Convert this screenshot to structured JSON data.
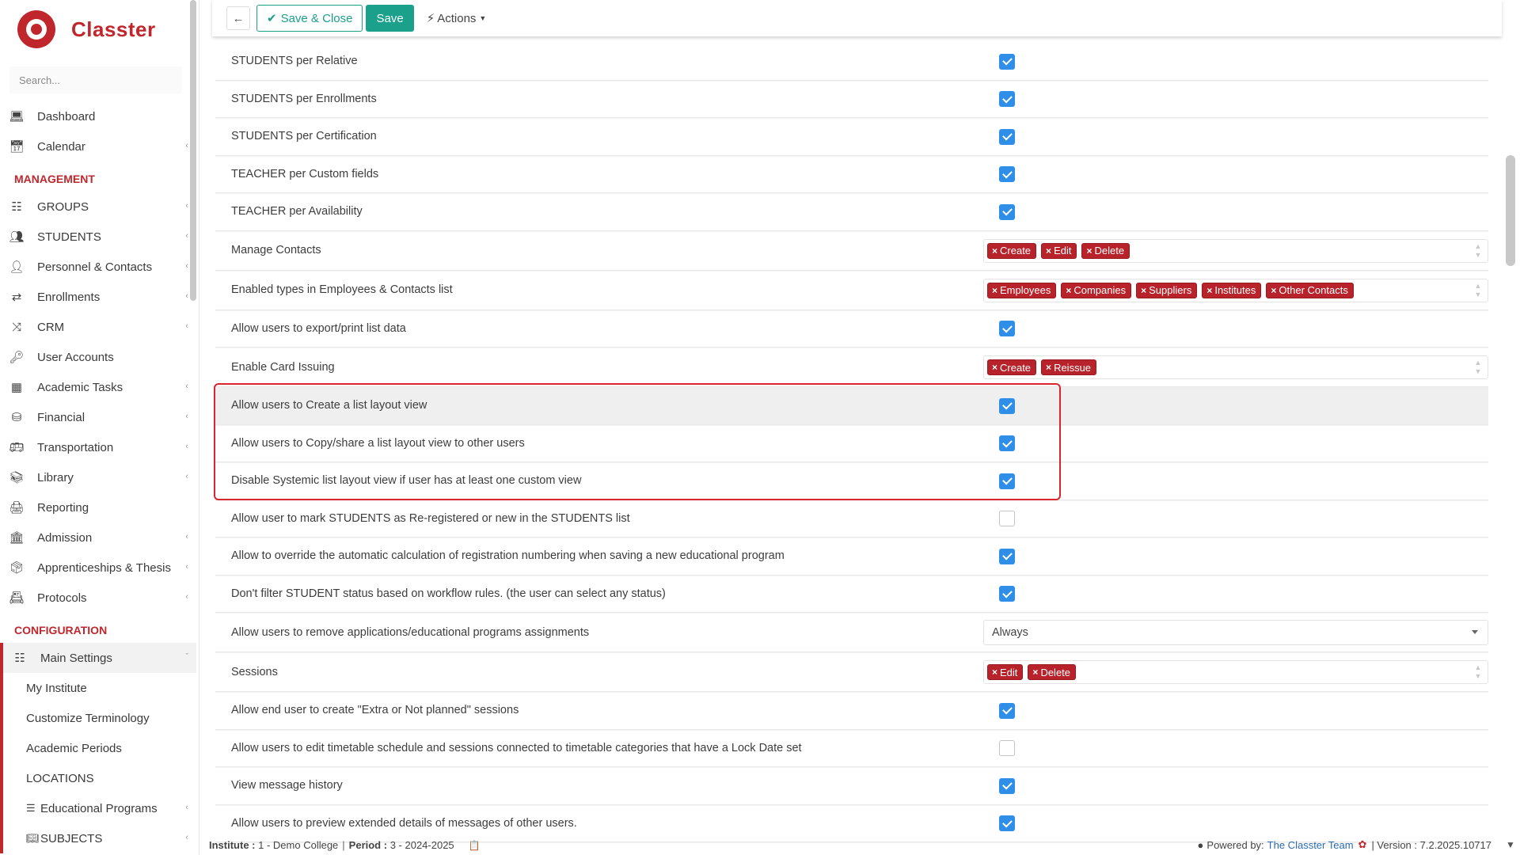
{
  "app": {
    "name": "Classter"
  },
  "search": {
    "placeholder": "Search..."
  },
  "toolbar": {
    "save_close_label": "Save & Close",
    "save_label": "Save",
    "actions_label": "Actions"
  },
  "sidebar": {
    "items_top": [
      {
        "label": "Dashboard",
        "icon": "laptop-icon",
        "chevron": false
      },
      {
        "label": "Calendar",
        "icon": "calendar-icon",
        "chevron": true
      }
    ],
    "section_management": "MANAGEMENT",
    "items_management": [
      {
        "label": "GROUPS",
        "icon": "groups-icon",
        "chevron": true
      },
      {
        "label": "STUDENTS",
        "icon": "students-icon",
        "chevron": true
      },
      {
        "label": "Personnel & Contacts",
        "icon": "person-icon",
        "chevron": true
      },
      {
        "label": "Enrollments",
        "icon": "exchange-icon",
        "chevron": true
      },
      {
        "label": "CRM",
        "icon": "shuffle-icon",
        "chevron": true
      },
      {
        "label": "User Accounts",
        "icon": "key-icon",
        "chevron": false
      },
      {
        "label": "Academic Tasks",
        "icon": "grid-icon",
        "chevron": true
      },
      {
        "label": "Financial",
        "icon": "coins-icon",
        "chevron": true
      },
      {
        "label": "Transportation",
        "icon": "bus-icon",
        "chevron": true
      },
      {
        "label": "Library",
        "icon": "books-icon",
        "chevron": true
      },
      {
        "label": "Reporting",
        "icon": "printer-icon",
        "chevron": false
      },
      {
        "label": "Admission",
        "icon": "institution-icon",
        "chevron": true
      },
      {
        "label": "Apprenticeships & Thesis",
        "icon": "box-icon",
        "chevron": true
      },
      {
        "label": "Protocols",
        "icon": "protocol-icon",
        "chevron": true
      }
    ],
    "section_configuration": "CONFIGURATION",
    "main_settings": "Main Settings",
    "sub_items": [
      {
        "label": "My Institute"
      },
      {
        "label": "Customize Terminology"
      },
      {
        "label": "Academic Periods"
      },
      {
        "label": "LOCATIONS"
      },
      {
        "label": "Educational Programs"
      },
      {
        "label": "SUBJECTS"
      }
    ]
  },
  "rows": [
    {
      "label": "STUDENTS per Relative",
      "type": "checkbox",
      "checked": true
    },
    {
      "label": "STUDENTS per Enrollments",
      "type": "checkbox",
      "checked": true
    },
    {
      "label": "STUDENTS per Certification",
      "type": "checkbox",
      "checked": true
    },
    {
      "label": "TEACHER per Custom fields",
      "type": "checkbox",
      "checked": true
    },
    {
      "label": "TEACHER per Availability",
      "type": "checkbox",
      "checked": true
    },
    {
      "label": "Manage Contacts",
      "type": "tags",
      "tags": [
        "Create",
        "Edit",
        "Delete"
      ]
    },
    {
      "label": "Enabled types in Employees & Contacts list",
      "type": "tags",
      "tags": [
        "Employees",
        "Companies",
        "Suppliers",
        "Institutes",
        "Other Contacts"
      ]
    },
    {
      "label": "Allow users to export/print list data",
      "type": "checkbox",
      "checked": true
    },
    {
      "label": "Enable Card Issuing",
      "type": "tags",
      "tags": [
        "Create",
        "Reissue"
      ]
    },
    {
      "label": "Allow users to Create a list layout view",
      "type": "checkbox",
      "checked": true,
      "highlight": true
    },
    {
      "label": "Allow users to Copy/share a list layout view to other users",
      "type": "checkbox",
      "checked": true
    },
    {
      "label": "Disable Systemic list layout view if user has at least one custom view",
      "type": "checkbox",
      "checked": true
    },
    {
      "label": "Allow user to mark STUDENTS as Re-registered or new in the STUDENTS list",
      "type": "checkbox",
      "checked": false
    },
    {
      "label": "Allow to override the automatic calculation of registration numbering when saving a new educational program",
      "type": "checkbox",
      "checked": true
    },
    {
      "label": "Don't filter STUDENT status based on workflow rules. (the user can select any status)",
      "type": "checkbox",
      "checked": true
    },
    {
      "label": "Allow users to remove applications/educational programs assignments",
      "type": "select",
      "value": "Always"
    },
    {
      "label": "Sessions",
      "type": "tags",
      "tags": [
        "Edit",
        "Delete"
      ]
    },
    {
      "label": "Allow end user to create \"Extra or Not planned\" sessions",
      "type": "checkbox",
      "checked": true
    },
    {
      "label": "Allow users to edit timetable schedule and sessions connected to timetable categories that have a Lock Date set",
      "type": "checkbox",
      "checked": false
    },
    {
      "label": "View message history",
      "type": "checkbox",
      "checked": true
    },
    {
      "label": "Allow users to preview extended details of messages of other users.",
      "type": "checkbox",
      "checked": true
    }
  ],
  "footer": {
    "institute_label": "Institute :",
    "institute_value": "1 - Demo College",
    "period_label": "Period :",
    "period_value": "3 - 2024-2025",
    "powered_by": "Powered by:",
    "team": "The Classter Team",
    "version": "| Version : 7.2.2025.10717"
  },
  "colors": {
    "brand": "#c0272d",
    "accent": "#1aa08b",
    "checkbox": "#2f8fe8",
    "tag": "#b8232b"
  }
}
